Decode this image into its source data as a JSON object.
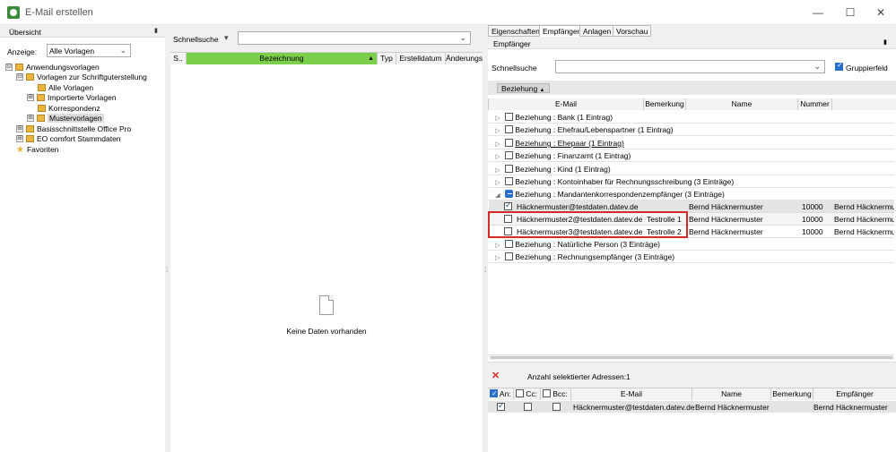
{
  "window": {
    "title": "E-Mail erstellen",
    "minimize": "—",
    "maximize": "☐",
    "close": "✕"
  },
  "left": {
    "title": "Übersicht",
    "pin": "📌",
    "filter_label": "Anzeige:",
    "filter_value": "Alle Vorlagen",
    "tree": [
      {
        "label": "Anwendungsvorlagen",
        "exp": "⊟"
      },
      {
        "label": "Vorlagen zur Schriftguterstellung",
        "exp": "⊟"
      },
      {
        "label": "Alle Vorlagen",
        "exp": ""
      },
      {
        "label": "Importierte Vorlagen",
        "exp": "⊞"
      },
      {
        "label": "Korrespondenz",
        "exp": ""
      },
      {
        "label": "Mustervorlagen",
        "exp": "⊞"
      },
      {
        "label": "Basisschnittstelle Office Pro",
        "exp": "⊞"
      },
      {
        "label": "EO comfort Stammdaten",
        "exp": "⊞"
      },
      {
        "label": "Favoriten",
        "exp": ""
      }
    ]
  },
  "middle": {
    "search_label": "Schnellsuche",
    "search_value": "",
    "columns": [
      "S..",
      "Bezeichnung",
      "Typ",
      "Erstelldatum",
      "Änderungs"
    ],
    "empty_text": "Keine Daten vorhanden"
  },
  "right": {
    "tabs": [
      "Eigenschaften",
      "Empfänger",
      "Anlagen",
      "Vorschau"
    ],
    "section_title": "Empfänger",
    "search_label": "Schnellsuche",
    "search_value": "",
    "group_checkbox_label": "Gruppierfeld",
    "group_chip": "Beziehung",
    "columns": [
      "E-Mail",
      "Bemerkung",
      "Name",
      "Nummer"
    ],
    "groups": [
      {
        "label": "Beziehung : Bank (1 Eintrag)",
        "expanded": false
      },
      {
        "label": "Beziehung : Ehefrau/Lebenspartner (1 Eintrag)",
        "expanded": false
      },
      {
        "label": "Beziehung : Ehepaar (1 Eintrag)",
        "expanded": false
      },
      {
        "label": "Beziehung : Finanzamt (1 Eintrag)",
        "expanded": false
      },
      {
        "label": "Beziehung : Kind (1 Eintrag)",
        "expanded": false
      },
      {
        "label": "Beziehung : Kontoinhaber für Rechnungsschreibung (3 Einträge)",
        "expanded": false
      },
      {
        "label": "Beziehung : Mandantenkorrespondenzempfänger (3 Einträge)",
        "expanded": true
      }
    ],
    "rows": [
      {
        "email": "Häcknermuster@testdaten.datev.de",
        "bemerkung": "",
        "name": "Bernd Häcknermuster",
        "nummer": "10000",
        "extra": "Bernd Häcknermus"
      },
      {
        "email": "Häcknermuster2@testdaten.datev.de",
        "bemerkung": "Testrolle 1",
        "name": "Bernd Häcknermuster",
        "nummer": "10000",
        "extra": "Bernd Häcknermus"
      },
      {
        "email": "Häcknermuster3@testdaten.datev.de",
        "bemerkung": "Testrolle 2",
        "name": "Bernd Häcknermuster",
        "nummer": "10000",
        "extra": "Bernd Häcknermus"
      }
    ],
    "groups_after": [
      {
        "label": "Beziehung : Natürliche Person (3 Einträge)"
      },
      {
        "label": "Beziehung : Rechnungsempfänger (3 Einträge)"
      }
    ],
    "selected_label": "Anzahl selektierter Adressen:",
    "selected_count": "1",
    "bottom_columns": [
      "An:",
      "Cc:",
      "Bcc:",
      "E-Mail",
      "Name",
      "Bemerkung",
      "Empfänger"
    ],
    "bottom_row": {
      "email": "Häcknermuster@testdaten.datev.de",
      "name": "Bernd Häcknermuster",
      "bemerkung": "",
      "empfaenger": "Bernd Häcknermuster"
    },
    "highlight_color": "#d42a2a",
    "accent": "#7ccf4a"
  }
}
